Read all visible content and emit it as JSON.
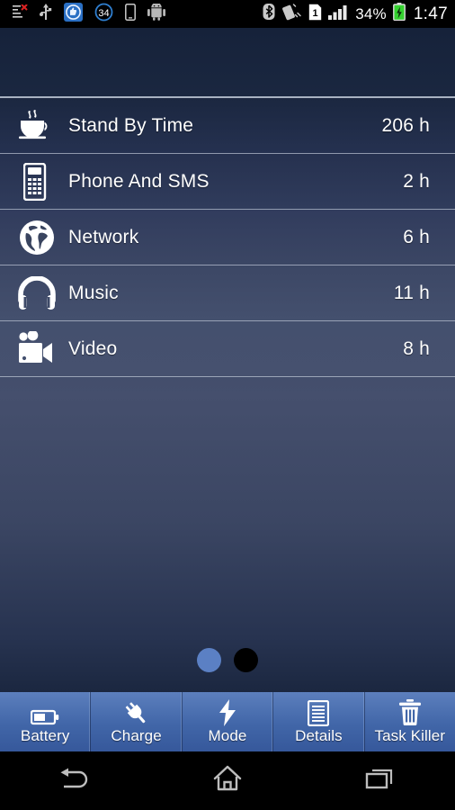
{
  "statusbar": {
    "left_icons": [
      {
        "name": "sync-error-icon",
        "label": "list with error"
      },
      {
        "name": "usb-icon",
        "label": "USB connected"
      },
      {
        "name": "app-notification-icon",
        "label": "cleaner app"
      },
      {
        "name": "count-badge-icon",
        "label": "34"
      },
      {
        "name": "device-icon",
        "label": "phone"
      },
      {
        "name": "android-icon",
        "label": "android"
      }
    ],
    "badge_count": "34",
    "right_icons": [
      {
        "name": "bluetooth-icon",
        "label": "Bluetooth"
      },
      {
        "name": "vibrate-icon",
        "label": "Vibrate"
      },
      {
        "name": "sim-1-icon",
        "label": "1"
      },
      {
        "name": "signal-bars-icon",
        "label": "Signal"
      }
    ],
    "sim_label": "1",
    "battery_percent": "34%",
    "battery_icon": "battery-charging-icon",
    "clock": "1:47"
  },
  "list": {
    "rows": [
      {
        "icon": "coffee-cup-icon",
        "label": "Stand By Time",
        "value": "206 h"
      },
      {
        "icon": "phone-sms-icon",
        "label": "Phone And SMS",
        "value": "2 h"
      },
      {
        "icon": "globe-icon",
        "label": "Network",
        "value": "6 h"
      },
      {
        "icon": "headphones-icon",
        "label": "Music",
        "value": "11 h"
      },
      {
        "icon": "video-camera-icon",
        "label": "Video",
        "value": "8 h"
      }
    ]
  },
  "pager": {
    "dots": [
      {
        "state": "active"
      },
      {
        "state": "inactive"
      }
    ],
    "active_index": 0,
    "active_color": "#5b80c4",
    "inactive_color": "#000000"
  },
  "toolbar": {
    "buttons": [
      {
        "icon": "battery-icon",
        "label": "Battery"
      },
      {
        "icon": "power-plug-icon",
        "label": "Charge"
      },
      {
        "icon": "lightning-icon",
        "label": "Mode"
      },
      {
        "icon": "document-icon",
        "label": "Details"
      },
      {
        "icon": "trash-icon",
        "label": "Task Killer"
      }
    ]
  },
  "navbar": {
    "buttons": [
      {
        "icon": "back-icon",
        "label": "Back"
      },
      {
        "icon": "home-icon",
        "label": "Home"
      },
      {
        "icon": "recents-icon",
        "label": "Recents"
      }
    ]
  },
  "theme": {
    "accent": "#5b80c4",
    "toolbar_blue": "#4166a8",
    "list_dark": "#1d2942",
    "list_light": "#454f6d",
    "text": "#ffffff"
  }
}
